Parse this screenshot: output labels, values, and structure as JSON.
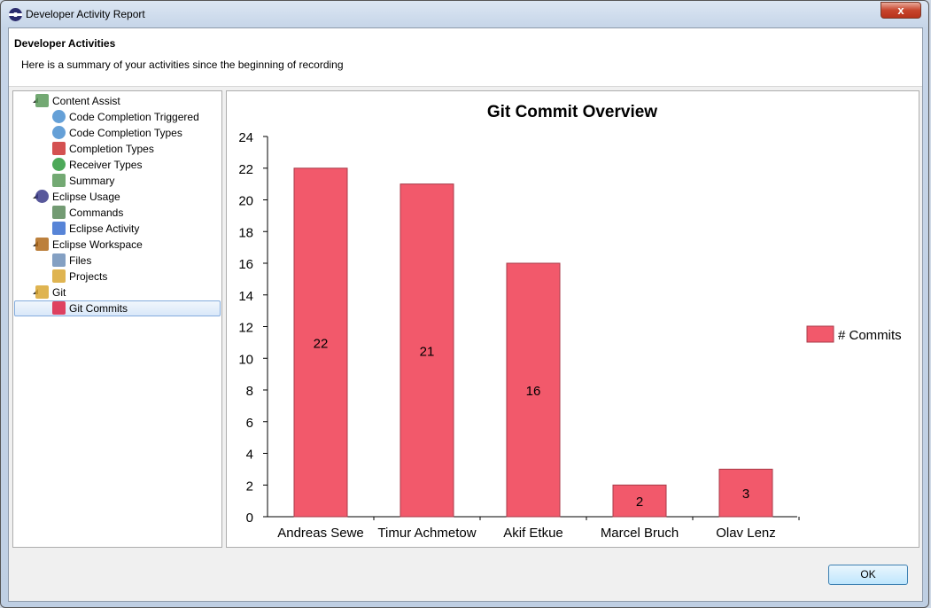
{
  "window": {
    "title": "Developer Activity Report",
    "close_label": "x"
  },
  "header": {
    "title": "Developer Activities",
    "subtitle": "Here is a summary of your activities since the beginning of recording"
  },
  "tree": [
    {
      "label": "Content Assist",
      "level": 0,
      "icon": "list-icon",
      "children": [
        {
          "label": "Code Completion Triggered",
          "icon": "pie-chart-icon"
        },
        {
          "label": "Code Completion Types",
          "icon": "pie-chart-icon"
        },
        {
          "label": "Completion Types",
          "icon": "shapes-icon"
        },
        {
          "label": "Receiver Types",
          "icon": "class-icon"
        },
        {
          "label": "Summary",
          "icon": "list-icon"
        }
      ]
    },
    {
      "label": "Eclipse Usage",
      "level": 0,
      "icon": "eclipse-icon",
      "children": [
        {
          "label": "Commands",
          "icon": "commands-icon"
        },
        {
          "label": "Eclipse Activity",
          "icon": "bar-chart-icon"
        }
      ]
    },
    {
      "label": "Eclipse Workspace",
      "level": 0,
      "icon": "workspace-icon",
      "children": [
        {
          "label": "Files",
          "icon": "file-icon"
        },
        {
          "label": "Projects",
          "icon": "folder-icon"
        }
      ]
    },
    {
      "label": "Git",
      "level": 0,
      "icon": "git-icon",
      "children": [
        {
          "label": "Git Commits",
          "icon": "git-commit-icon",
          "selected": true
        }
      ]
    }
  ],
  "buttons": {
    "ok": "OK"
  },
  "chart_data": {
    "type": "bar",
    "title": "Git Commit Overview",
    "categories": [
      "Andreas Sewe",
      "Timur Achmetow",
      "Akif Etkue",
      "Marcel Bruch",
      "Olav Lenz"
    ],
    "series": [
      {
        "name": "# Commits",
        "values": [
          22,
          21,
          16,
          2,
          3
        ],
        "color": "#f2596b"
      }
    ],
    "data_labels": [
      "22",
      "21",
      "16",
      "2",
      "3"
    ],
    "ylim": [
      0,
      24
    ],
    "yticks": [
      "0",
      "2",
      "4",
      "6",
      "8",
      "10",
      "12",
      "14",
      "16",
      "18",
      "20",
      "22",
      "24"
    ],
    "legend": "right",
    "grid": false
  }
}
